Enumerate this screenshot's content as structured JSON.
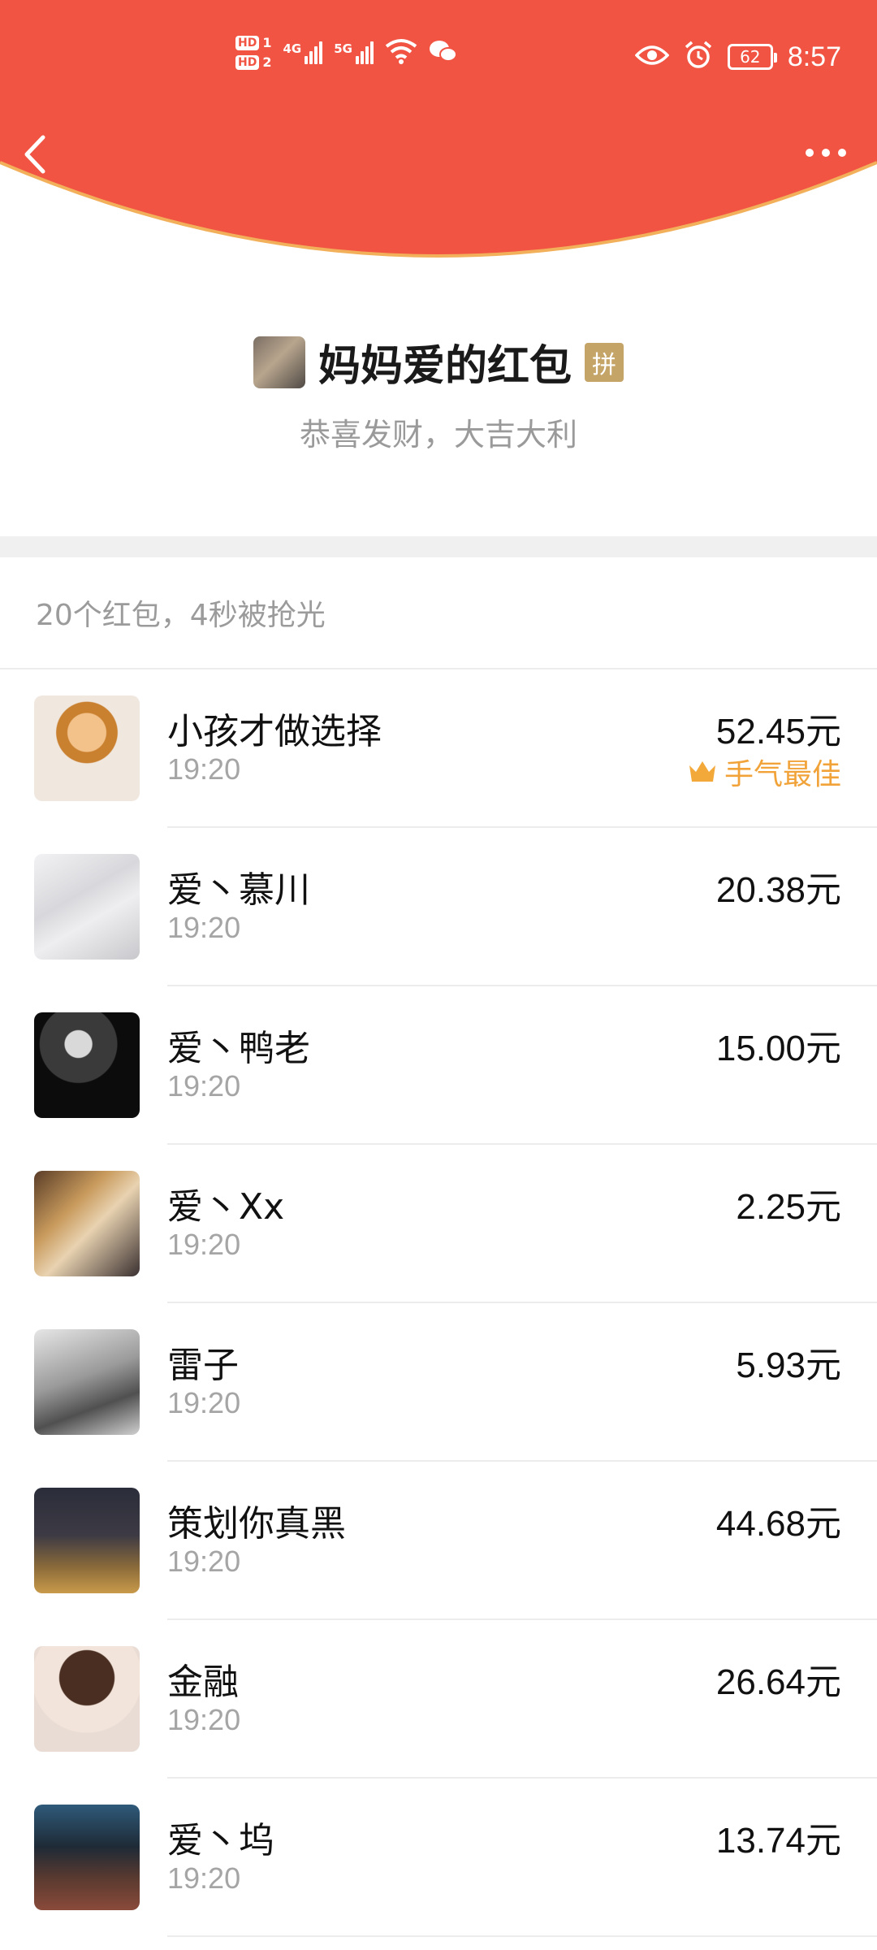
{
  "status_bar": {
    "hd1": "HD",
    "hd1_num": "1",
    "hd2": "HD",
    "hd2_num": "2",
    "net1": "4G",
    "net2": "5G",
    "battery": "62",
    "time": "8:57"
  },
  "header": {
    "color": "#f25443",
    "back_icon": "chevron-left-icon",
    "more_icon": "more-dots-icon"
  },
  "sender": {
    "title": "妈妈爱的红包",
    "badge": "拼",
    "blessing": "恭喜发财，大吉大利"
  },
  "summary": "20个红包，4秒被抢光",
  "recipients": [
    {
      "name": "小孩才做选择",
      "time": "19:20",
      "amount": "52.45元",
      "best": "手气最佳"
    },
    {
      "name": "爱丶慕川",
      "time": "19:20",
      "amount": "20.38元"
    },
    {
      "name": "爱丶鸭老",
      "time": "19:20",
      "amount": "15.00元"
    },
    {
      "name": "爱丶Xx",
      "time": "19:20",
      "amount": "2.25元"
    },
    {
      "name": "雷子",
      "time": "19:20",
      "amount": "5.93元"
    },
    {
      "name": "策划你真黑",
      "time": "19:20",
      "amount": "44.68元"
    },
    {
      "name": "金融",
      "time": "19:20",
      "amount": "26.64元"
    },
    {
      "name": "爱丶坞",
      "time": "19:20",
      "amount": "13.74元"
    }
  ]
}
